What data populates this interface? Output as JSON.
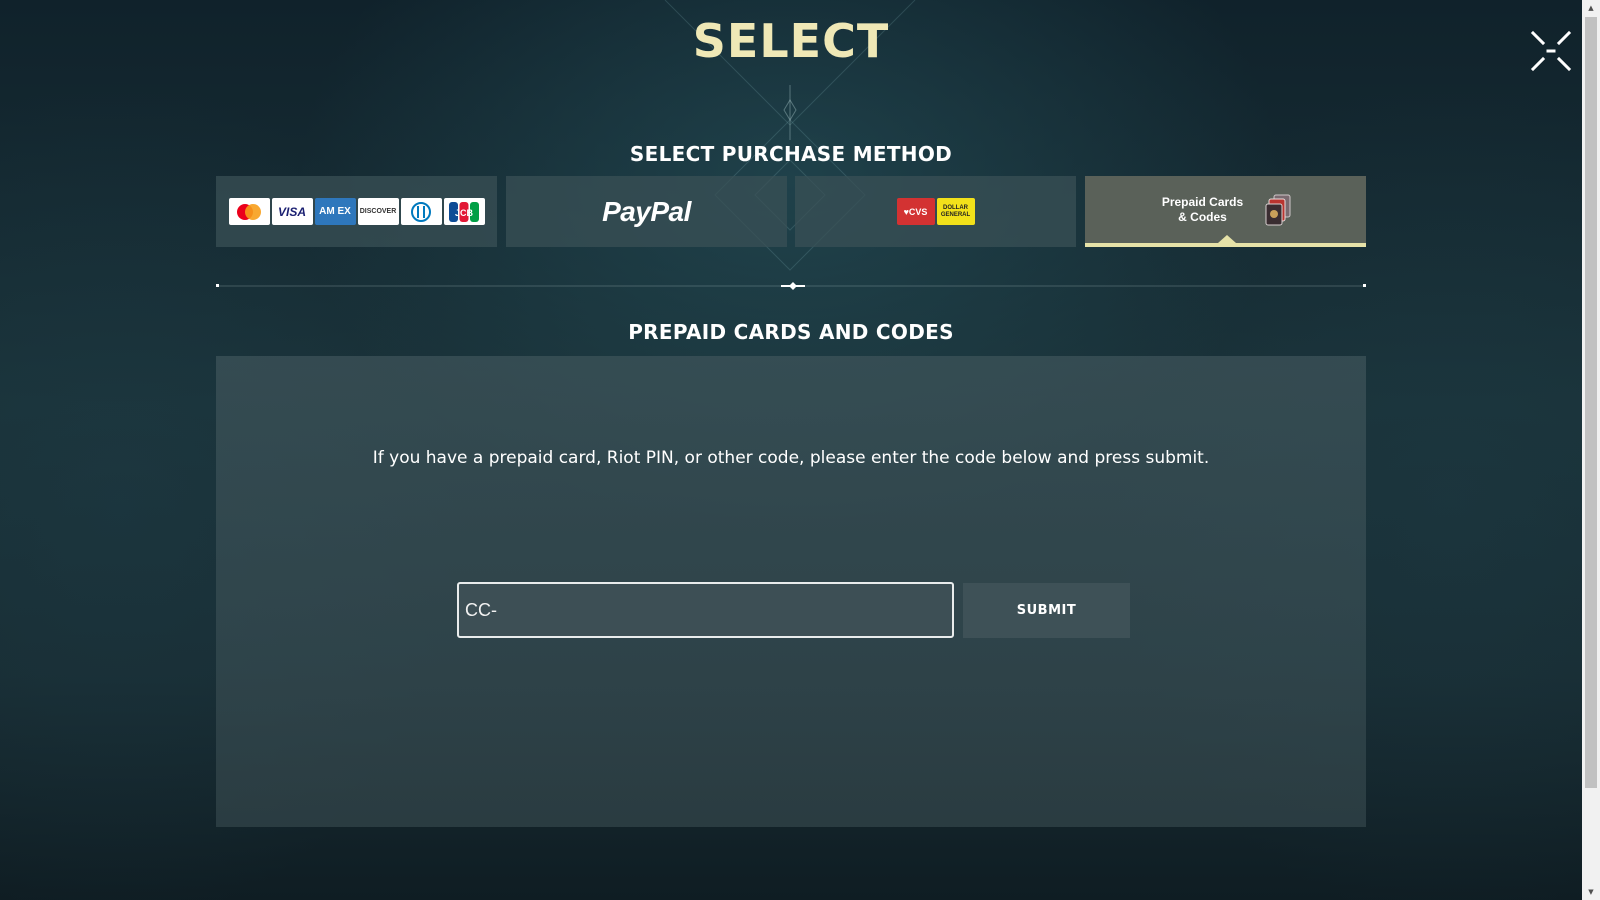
{
  "header": {
    "logo_text": "SELECT",
    "close_icon": "close-collapse-icon"
  },
  "purchase": {
    "title": "SELECT PURCHASE METHOD",
    "methods": [
      {
        "id": "cards",
        "icons": [
          {
            "name": "mastercard-logo",
            "label": ""
          },
          {
            "name": "visa-logo",
            "label": "VISA"
          },
          {
            "name": "amex-logo",
            "label": "AM EX"
          },
          {
            "name": "discover-logo",
            "label": "DISCOVER"
          },
          {
            "name": "diners-club-logo",
            "label": ""
          },
          {
            "name": "jcb-logo",
            "label": "JCB"
          }
        ]
      },
      {
        "id": "paypal",
        "label": "PayPal"
      },
      {
        "id": "retail",
        "cvs_label": "♥CVS",
        "dg_label": "DOLLAR GENERAL"
      },
      {
        "id": "prepaid",
        "label": "Prepaid Cards & Codes",
        "selected": true
      }
    ]
  },
  "prepaid_section": {
    "title": "PREPAID CARDS AND CODES",
    "instructions": "If you have a prepaid card, Riot PIN, or other code, please enter the code below and press submit.",
    "code_value": "CC-",
    "submit_label": "SUBMIT"
  },
  "colors": {
    "logo": "#efe8b6",
    "selected_accent": "#e6e2a8",
    "panel": "#3e545a",
    "background": "#13232b"
  }
}
